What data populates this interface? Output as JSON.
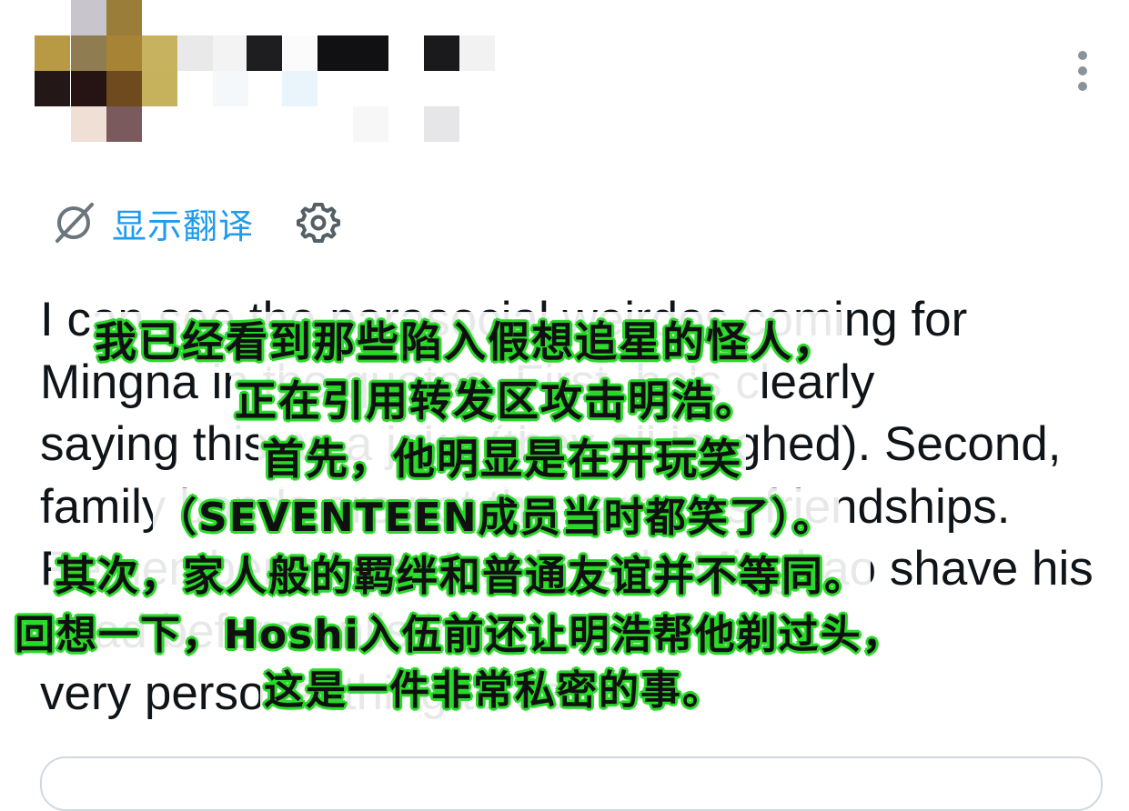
{
  "header": {
    "author_censored": true,
    "more_icon": "more-vertical-icon"
  },
  "translate": {
    "label": "显示翻译",
    "icon": "translate-off-icon",
    "settings_icon": "gear-icon",
    "color": "#1d9bf0"
  },
  "tweet": {
    "lines": [
      "I can see the parasocial weirdos coming for",
      "Mingna in the quotes. First, he's clearly",
      "saying this as a joke (they all laughed). Second,",
      "family bonds are not the same as friendships.",
      "Remember when Hoshi made Minghao shave his",
      "head before enlisting...",
      "very personal thing to do."
    ]
  },
  "subtitles": {
    "lines": [
      "我已经看到那些陷入假想追星的怪人，",
      "正在引用转发区攻击明浩。",
      "首先，他明显是在开玩笑",
      "（SEVENTEEN成员当时都笑了）。",
      "其次，家人般的羁绊和普通友谊并不等同。",
      "回想一下，Hoshi入伍前还让明浩帮他剃过头，",
      "这是一件非常私密的事。"
    ],
    "outline_color": "#29d629"
  }
}
